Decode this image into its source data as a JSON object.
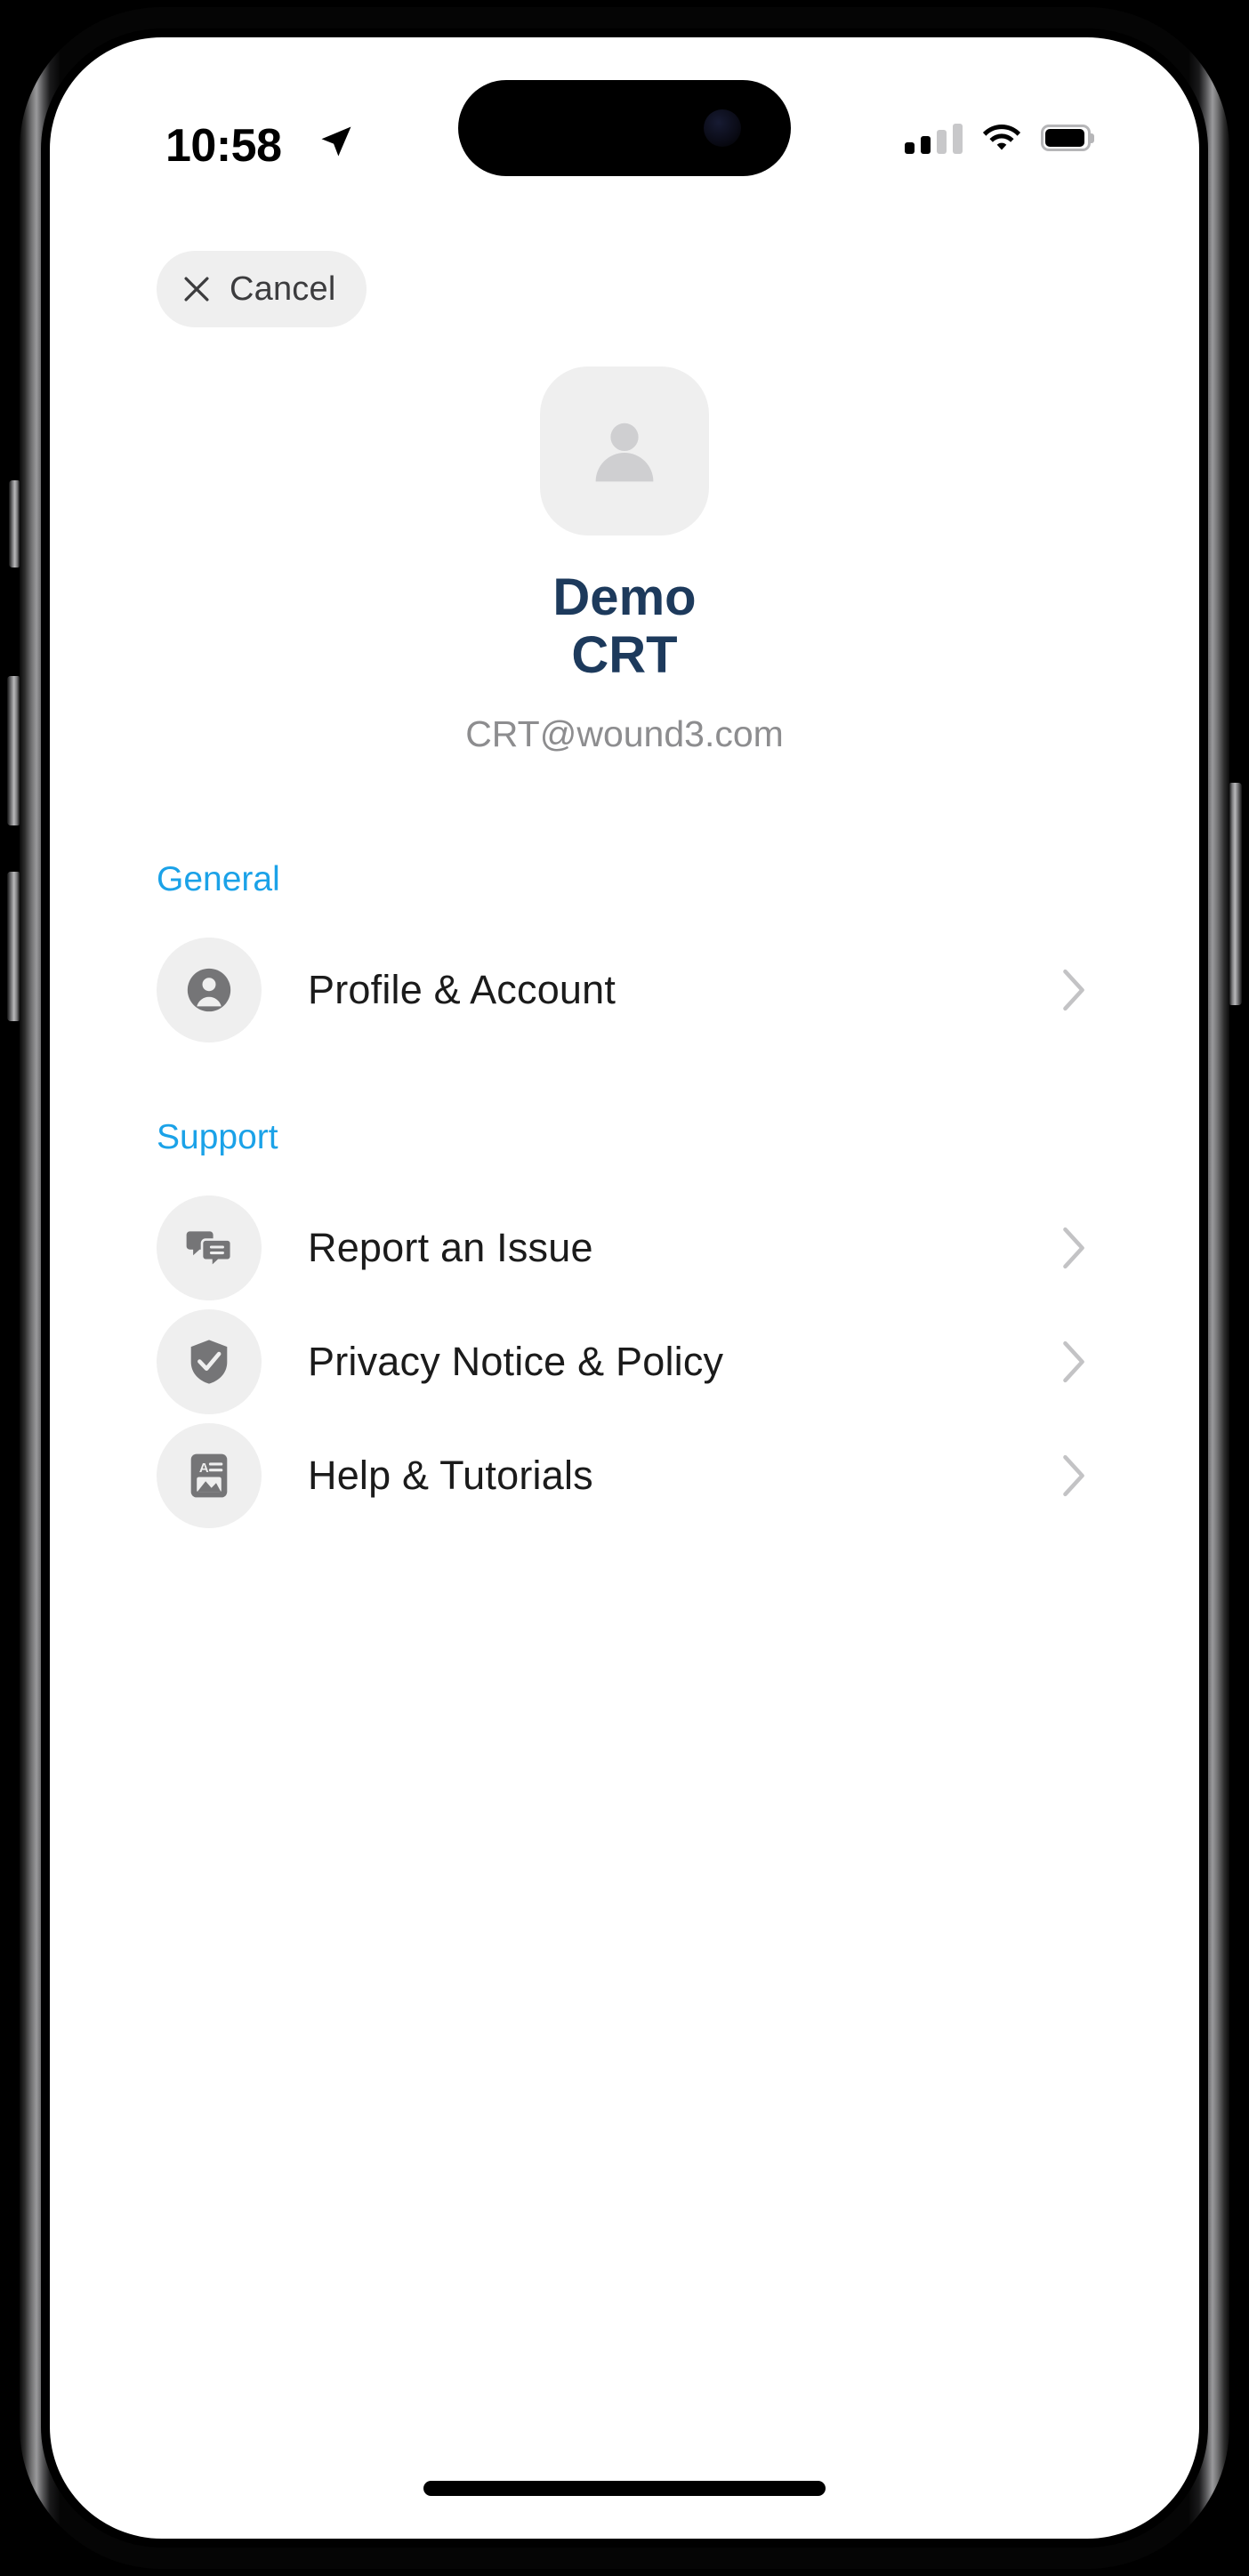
{
  "status_bar": {
    "time": "10:58",
    "location_icon": "location-arrow-icon",
    "cellular_icon": "cellular-signal-icon",
    "cellular_bars_filled": 2,
    "cellular_bars_total": 4,
    "wifi_icon": "wifi-icon",
    "battery_icon": "battery-icon",
    "battery_level_percent": 95
  },
  "nav": {
    "cancel_label": "Cancel",
    "cancel_icon": "close-x-icon"
  },
  "profile": {
    "avatar_icon": "person-placeholder-icon",
    "name_line1": "Demo",
    "name_line2": "CRT",
    "email": "CRT@wound3.com"
  },
  "sections": [
    {
      "title": "General",
      "items": [
        {
          "label": "Profile & Account",
          "icon": "person-circle-icon",
          "accessory": "chevron-right-icon"
        }
      ]
    },
    {
      "title": "Support",
      "items": [
        {
          "label": "Report an Issue",
          "icon": "chat-bubbles-icon",
          "accessory": "chevron-right-icon"
        },
        {
          "label": "Privacy Notice & Policy",
          "icon": "shield-check-icon",
          "accessory": "chevron-right-icon"
        },
        {
          "label": "Help & Tutorials",
          "icon": "article-document-icon",
          "accessory": "chevron-right-icon"
        }
      ]
    }
  ],
  "colors": {
    "accent_blue": "#1BA2E8",
    "name_navy": "#1D3A5C",
    "email_gray": "#8D8D8F",
    "icon_bg": "#EFEFEF",
    "icon_glyph": "#757577",
    "chevron": "#C3C3C5",
    "row_label": "#1B1B1B"
  },
  "home_indicator": "home-indicator-bar"
}
